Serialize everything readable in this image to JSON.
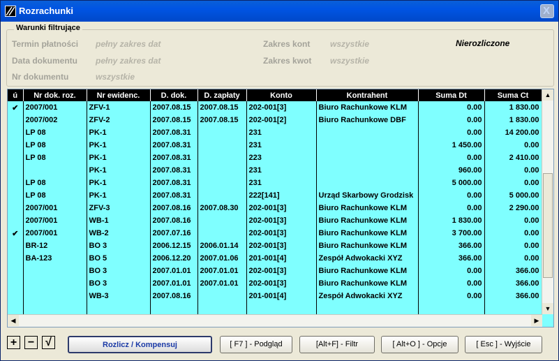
{
  "window": {
    "title": "Rozrachunki",
    "close_label": "X"
  },
  "filters": {
    "group_title": "Warunki filtrujące",
    "termin_label": "Termin płatności",
    "termin_value": "pełny zakres dat",
    "data_dok_label": "Data dokumentu",
    "data_dok_value": "pełny zakres dat",
    "nr_dok_label": "Nr dokumentu",
    "nr_dok_value": "wszystkie",
    "zakres_kont_label": "Zakres kont",
    "zakres_kont_value": "wszystkie",
    "zakres_kwot_label": "Zakres kwot",
    "zakres_kwot_value": "wszystkie",
    "status": "Nierozliczone"
  },
  "table": {
    "columns": [
      "ú",
      "Nr dok. roz.",
      "Nr ewidenc.",
      "D. dok.",
      "D. zapłaty",
      "Konto",
      "Kontrahent",
      "Suma Dt",
      "Suma Ct"
    ],
    "rows": [
      [
        "✔",
        "2007/001",
        "ZFV-1",
        "2007.08.15",
        "2007.08.15",
        "202-001[3]",
        "Biuro Rachunkowe KLM",
        "0.00",
        "1 830.00"
      ],
      [
        "",
        "2007/002",
        "ZFV-2",
        "2007.08.15",
        "2007.08.15",
        "202-001[2]",
        "Biuro Rachunkowe DBF",
        "0.00",
        "1 830.00"
      ],
      [
        "",
        "LP 08",
        "PK-1",
        "2007.08.31",
        "",
        "231",
        "",
        "0.00",
        "14 200.00"
      ],
      [
        "",
        "LP 08",
        "PK-1",
        "2007.08.31",
        "",
        "231",
        "",
        "1 450.00",
        "0.00"
      ],
      [
        "",
        "LP 08",
        "PK-1",
        "2007.08.31",
        "",
        "223",
        "",
        "0.00",
        "2 410.00"
      ],
      [
        "",
        "",
        "PK-1",
        "2007.08.31",
        "",
        "231",
        "",
        "960.00",
        "0.00"
      ],
      [
        "",
        "LP 08",
        "PK-1",
        "2007.08.31",
        "",
        "231",
        "",
        "5 000.00",
        "0.00"
      ],
      [
        "",
        "LP 08",
        "PK-1",
        "2007.08.31",
        "",
        "222[141]",
        "Urząd Skarbowy Grodzisk",
        "0.00",
        "5 000.00"
      ],
      [
        "",
        "2007/001",
        "ZFV-3",
        "2007.08.16",
        "2007.08.30",
        "202-001[3]",
        "Biuro Rachunkowe KLM",
        "0.00",
        "2 290.00"
      ],
      [
        "",
        "2007/001",
        "WB-1",
        "2007.08.16",
        "",
        "202-001[3]",
        "Biuro Rachunkowe KLM",
        "1 830.00",
        "0.00"
      ],
      [
        "✔",
        "2007/001",
        "WB-2",
        "2007.07.16",
        "",
        "202-001[3]",
        "Biuro Rachunkowe KLM",
        "3 700.00",
        "0.00"
      ],
      [
        "",
        "BR-12",
        "BO 3",
        "2006.12.15",
        "2006.01.14",
        "202-001[3]",
        "Biuro Rachunkowe KLM",
        "366.00",
        "0.00"
      ],
      [
        "",
        "BA-123",
        "BO 5",
        "2006.12.20",
        "2007.01.06",
        "201-001[4]",
        "Zespół Adwokacki XYZ",
        "366.00",
        "0.00"
      ],
      [
        "",
        "",
        "BO 3",
        "2007.01.01",
        "2007.01.01",
        "202-001[3]",
        "Biuro Rachunkowe KLM",
        "0.00",
        "366.00"
      ],
      [
        "",
        "",
        "BO 3",
        "2007.01.01",
        "2007.01.01",
        "202-001[3]",
        "Biuro Rachunkowe KLM",
        "0.00",
        "366.00"
      ],
      [
        "",
        "",
        "WB-3",
        "2007.08.16",
        "",
        "201-001[4]",
        "Zespół Adwokacki XYZ",
        "0.00",
        "366.00"
      ],
      [
        "",
        "",
        "",
        "",
        "",
        "",
        "",
        "",
        ""
      ]
    ]
  },
  "toolbar": {
    "add_icon": "+",
    "remove_icon": "−",
    "check_icon": "√",
    "settle_label": "Rozlicz / Kompensuj",
    "preview_label": "[ F7 ] - Podgląd",
    "filter_label": "[Alt+F] - Filtr",
    "options_label": "[ Alt+O ] - Opcje",
    "exit_label": "[ Esc ] - Wyjście"
  }
}
